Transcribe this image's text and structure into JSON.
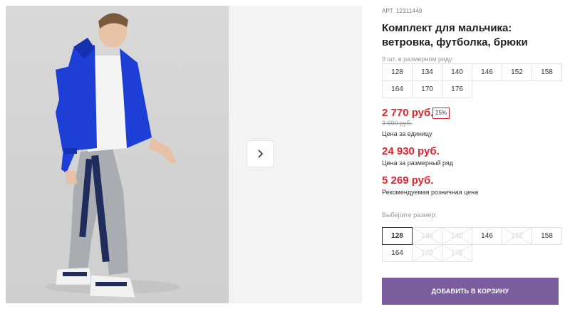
{
  "gallery": {
    "next_icon": "chevron-right-icon"
  },
  "product": {
    "article_label": "АРТ.",
    "article_number": "12311449",
    "title": "Комплект для мальчика: ветровка, футболка, брюки",
    "pack_note": "9 шт. в размерном ряду",
    "pack_sizes": [
      "128",
      "134",
      "140",
      "146",
      "152",
      "158",
      "164",
      "170",
      "176"
    ]
  },
  "pricing": {
    "unit_price": "2 770 руб.",
    "discount": "25%",
    "old_price": "3 690 руб.",
    "unit_caption": "Цена за единицу",
    "pack_price": "24 930 руб.",
    "pack_caption": "Цена за размерный ряд",
    "rrp_price": "5 269 руб.",
    "rrp_caption": "Рекомендуемая розничная цена",
    "accent_color": "#e0242e"
  },
  "size_selector": {
    "label": "Выберите размер:",
    "sizes": [
      {
        "label": "128",
        "state": "selected"
      },
      {
        "label": "134",
        "state": "disabled"
      },
      {
        "label": "140",
        "state": "disabled"
      },
      {
        "label": "146",
        "state": "available"
      },
      {
        "label": "152",
        "state": "disabled"
      },
      {
        "label": "158",
        "state": "available"
      },
      {
        "label": "164",
        "state": "available"
      },
      {
        "label": "170",
        "state": "disabled"
      },
      {
        "label": "176",
        "state": "disabled"
      }
    ]
  },
  "cart": {
    "button_label": "ДОБАВИТЬ В КОРЗИНУ",
    "button_color": "#7b5c9c"
  }
}
